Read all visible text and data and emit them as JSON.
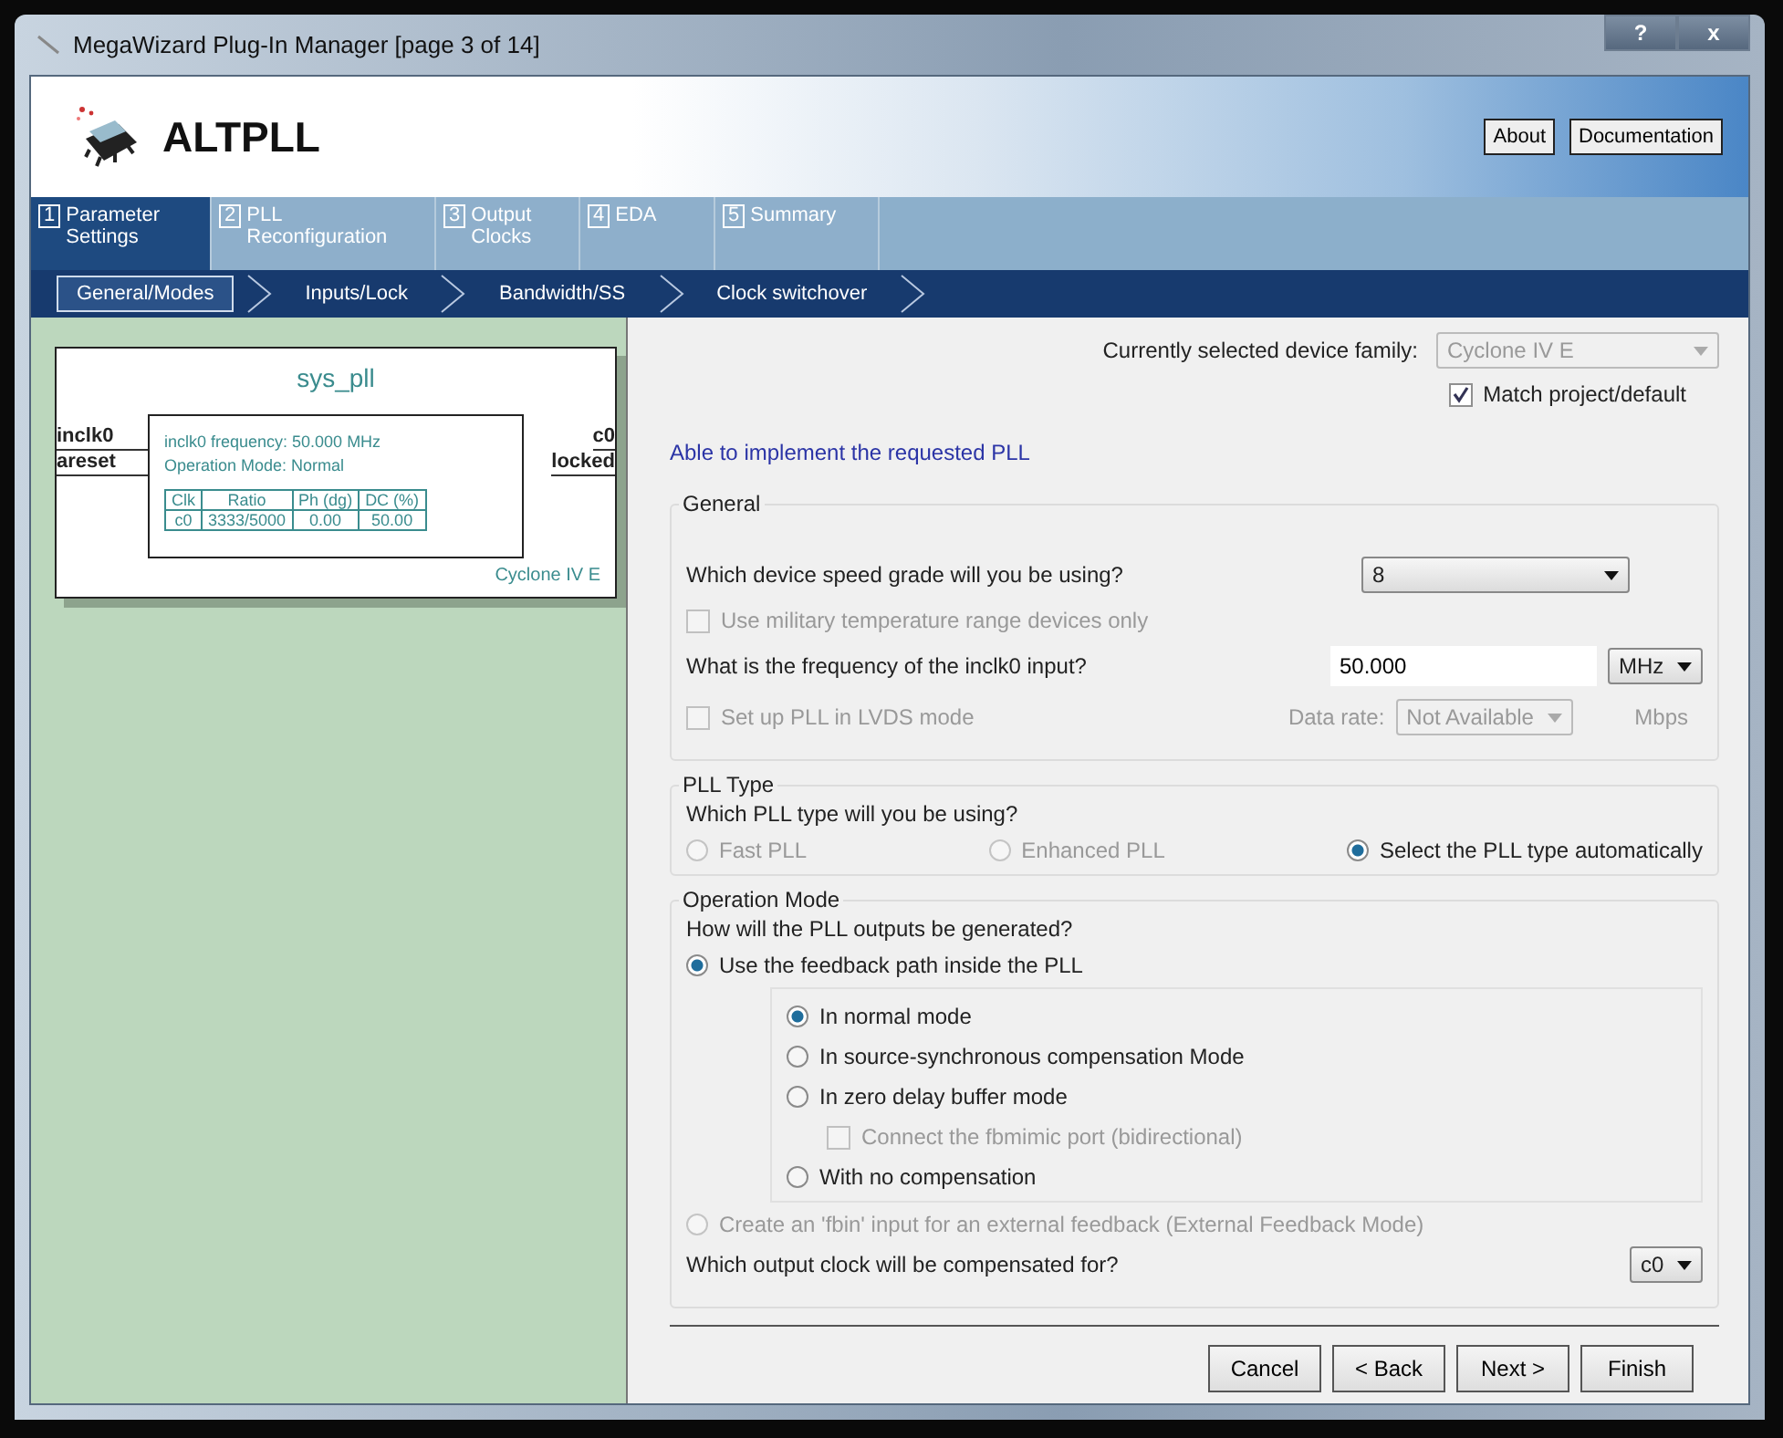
{
  "window": {
    "title": "MegaWizard Plug-In Manager [page 3 of 14]",
    "help": "?",
    "close": "x"
  },
  "header": {
    "title": "ALTPLL",
    "buttons": [
      "About",
      "Documentation"
    ]
  },
  "tabs": [
    {
      "num": "1",
      "label": "Parameter Settings",
      "selected": true
    },
    {
      "num": "2",
      "label": "PLL Reconfiguration",
      "selected": false
    },
    {
      "num": "3",
      "label": "Output Clocks",
      "selected": false
    },
    {
      "num": "4",
      "label": "EDA",
      "selected": false
    },
    {
      "num": "5",
      "label": "Summary",
      "selected": false
    }
  ],
  "subtabs": [
    {
      "label": "General/Modes",
      "selected": true
    },
    {
      "label": "Inputs/Lock",
      "selected": false
    },
    {
      "label": "Bandwidth/SS",
      "selected": false
    },
    {
      "label": "Clock switchover",
      "selected": false
    }
  ],
  "diagram": {
    "name": "sys_pll",
    "inputs": [
      "inclk0",
      "areset"
    ],
    "outputs": [
      "c0",
      "locked"
    ],
    "info": [
      "inclk0 frequency: 50.000 MHz",
      "Operation Mode: Normal"
    ],
    "columns": [
      "Clk",
      "Ratio",
      "Ph (dg)",
      "DC (%)"
    ],
    "rows": [
      [
        "c0",
        "3333/5000",
        "0.00",
        "50.00"
      ]
    ],
    "device": "Cyclone IV E"
  },
  "device_family": {
    "label": "Currently selected device family:",
    "value": "Cyclone IV E",
    "match": {
      "label": "Match project/default",
      "checked": true
    }
  },
  "status": "Able to implement the requested PLL",
  "general": {
    "title": "General",
    "speed": {
      "label": "Which device speed grade will you be using?",
      "value": "8"
    },
    "military": {
      "label": "Use military temperature range devices only",
      "checked": false,
      "disabled": true
    },
    "frequency": {
      "label": "What is the frequency of the inclk0 input?",
      "value": "50.000",
      "unit": "MHz"
    },
    "lvds": {
      "label": "Set up PLL in LVDS mode",
      "checked": false,
      "disabled": true,
      "rate_label": "Data rate:",
      "rate_value": "Not Available",
      "rate_unit": "Mbps"
    }
  },
  "pll_type": {
    "title": "PLL Type",
    "question": "Which PLL type will you be using?",
    "options": [
      {
        "label": "Fast PLL",
        "selected": false,
        "disabled": true
      },
      {
        "label": "Enhanced PLL",
        "selected": false,
        "disabled": true
      },
      {
        "label": "Select the PLL type automatically",
        "selected": true,
        "disabled": false
      }
    ]
  },
  "operation": {
    "title": "Operation Mode",
    "question": "How will the PLL outputs be generated?",
    "feedback": {
      "label": "Use the feedback path inside the PLL",
      "selected": true,
      "disabled": false
    },
    "modes": [
      {
        "kind": "radio",
        "label": "In normal mode",
        "selected": true,
        "disabled": false
      },
      {
        "kind": "radio",
        "label": "In source-synchronous compensation Mode",
        "selected": false,
        "disabled": false
      },
      {
        "kind": "radio",
        "label": "In zero delay buffer mode",
        "selected": false,
        "disabled": false
      },
      {
        "kind": "checkbox",
        "label": "Connect the fbmimic port (bidirectional)",
        "checked": false,
        "disabled": true
      },
      {
        "kind": "radio",
        "label": "With no compensation",
        "selected": false,
        "disabled": false
      }
    ],
    "external": {
      "label": "Create an 'fbin' input for an external feedback (External Feedback Mode)",
      "selected": false,
      "disabled": true
    },
    "compensate": {
      "label": "Which output clock will be compensated for?",
      "value": "c0"
    }
  },
  "buttons": [
    "Cancel",
    "< Back",
    "Next >",
    "Finish"
  ]
}
